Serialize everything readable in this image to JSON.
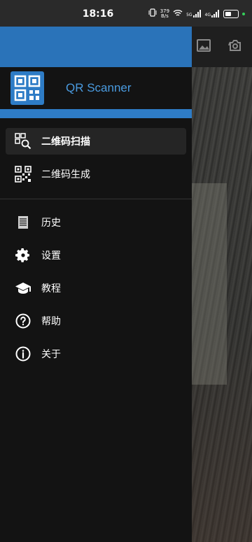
{
  "status_bar": {
    "time": "18:16",
    "net_speed_top": "379",
    "net_speed_unit": "B/s",
    "sim1": "5G",
    "sim2": "4G"
  },
  "app": {
    "title": "QR Scanner",
    "accent": "#2e7cc6"
  },
  "menu": {
    "scan": "二维码扫描",
    "generate": "二维码生成",
    "history": "历史",
    "settings": "设置",
    "tutorial": "教程",
    "help": "帮助",
    "about": "关于"
  },
  "icons": {
    "gallery": "image-icon",
    "flip_camera": "camera-switch-icon"
  }
}
